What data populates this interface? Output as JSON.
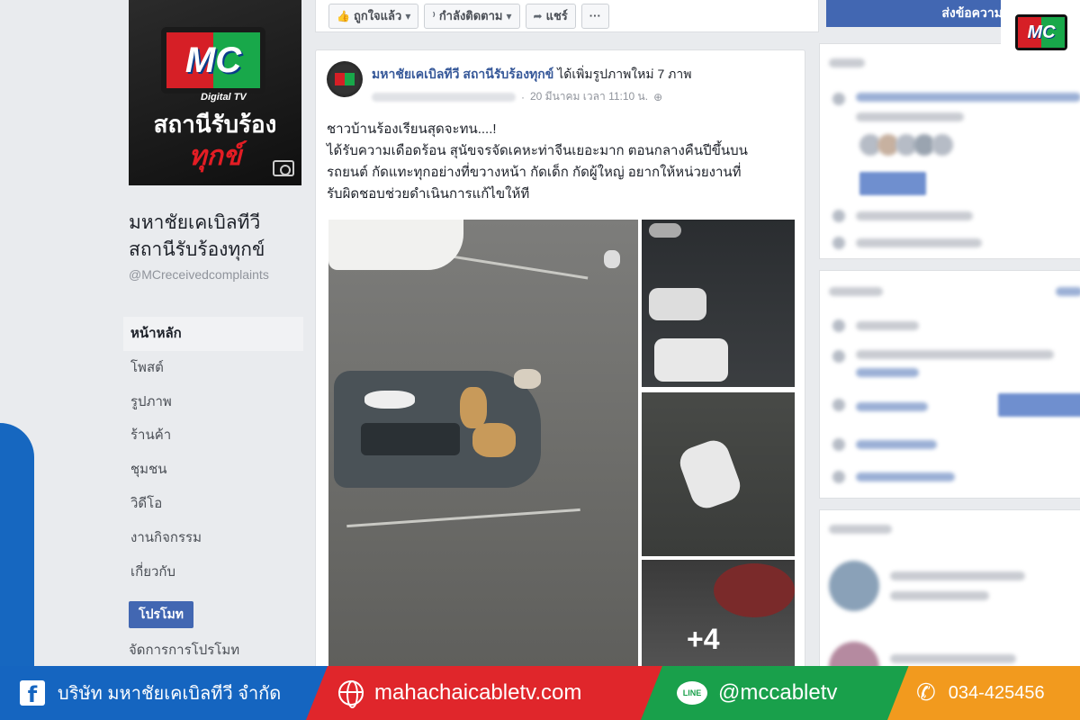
{
  "topbar": {
    "like_label": "ถูกใจแล้ว",
    "follow_label": "กำลังติดตาม",
    "share_label": "แชร์",
    "more_label": "···",
    "send_message_label": "ส่งข้อความ"
  },
  "cover": {
    "logo_text": "MC",
    "logo_sub": "Digital TV",
    "title_line1": "สถานีรับร้อง",
    "title_line2": "ทุกข์"
  },
  "page": {
    "name": "มหาชัยเคเบิลทีวี สถานีรับร้องทุกข์",
    "handle": "@MCreceivedcomplaints"
  },
  "nav": {
    "items": [
      {
        "label": "หน้าหลัก",
        "active": true
      },
      {
        "label": "โพสต์"
      },
      {
        "label": "รูปภาพ"
      },
      {
        "label": "ร้านค้า"
      },
      {
        "label": "ชุมชน"
      },
      {
        "label": "วิดีโอ"
      },
      {
        "label": "งานกิจกรรม"
      },
      {
        "label": "เกี่ยวกับ"
      }
    ],
    "promote_label": "โปรโมท",
    "manage_promotions_label": "จัดการการโปรโมท"
  },
  "post": {
    "author": "มหาชัยเคเบิลทีวี สถานีรับร้องทุกข์",
    "action": "ได้เพิ่มรูปภาพใหม่ 7 ภาพ",
    "timestamp": "20 มีนาคม เวลา 11:10 น.",
    "text_line1": "ชาวบ้านร้องเรียนสุดจะทน....!",
    "text_line2": "ได้รับความเดือดร้อน สุนัขจรจัดเคหะท่าจีนเยอะมาก ตอนกลางคืนปีขึ้นบน",
    "text_line3": "รถยนต์ กัดแทะทุกอย่างที่ขวางหน้า กัดเด็ก กัดผู้ใหญ่ อยากให้หน่วยงานที่",
    "text_line4": "รับผิดชอบช่วยดำเนินการแก้ไขให้ที",
    "more_photos": "+4"
  },
  "banner": {
    "company": "บริษัท มหาชัยเคเบิลทีวี จำกัด",
    "website": "mahachaicabletv.com",
    "line_label": "LINE",
    "line_id": "@mccabletv",
    "phone": "034-425456"
  },
  "colors": {
    "fb_blue": "#4267b2",
    "banner_blue": "#1565c0",
    "banner_red": "#e0262b",
    "banner_green": "#19a04b",
    "banner_orange": "#f29a1e"
  }
}
